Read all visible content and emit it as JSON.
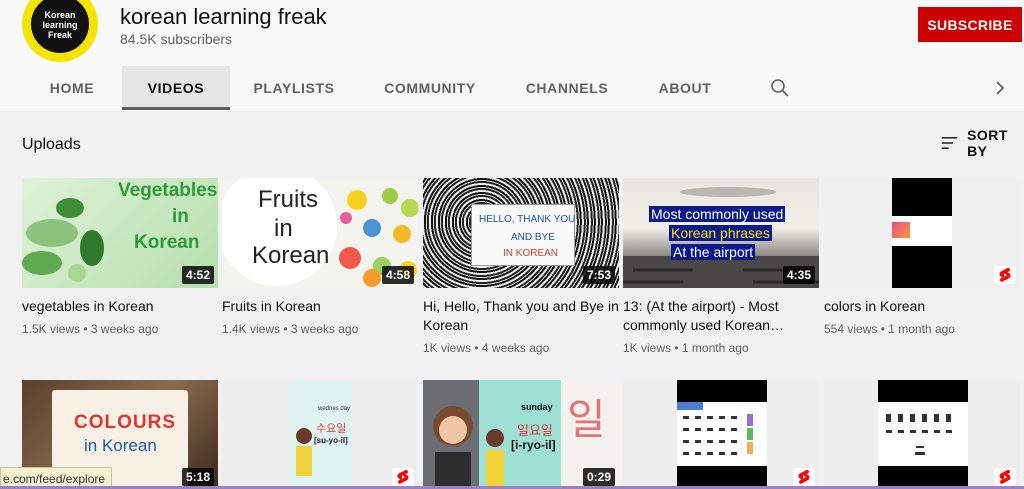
{
  "channel": {
    "name": "korean learning freak",
    "subscribers": "84.5K subscribers",
    "avatar_text": "Korean learning Freak",
    "subscribe_label": "SUBSCRIBE"
  },
  "tabs": [
    {
      "label": "HOME"
    },
    {
      "label": "VIDEOS",
      "active": true
    },
    {
      "label": "PLAYLISTS"
    },
    {
      "label": "COMMUNITY"
    },
    {
      "label": "CHANNELS"
    },
    {
      "label": "ABOUT"
    }
  ],
  "section": {
    "title": "Uploads",
    "sort_label": "SORT BY"
  },
  "videos_row1": [
    {
      "title": "vegetables in Korean",
      "views": "1.5K views",
      "age": "3 weeks ago",
      "duration": "4:52",
      "thumb_text": [
        "Vegetables",
        "in",
        "Korean"
      ]
    },
    {
      "title": "Fruits in Korean",
      "views": "1.4K views",
      "age": "3 weeks ago",
      "duration": "4:58",
      "thumb_text": [
        "Fruits",
        "in",
        "Korean"
      ]
    },
    {
      "title": "Hi, Hello, Thank you and Bye in Korean",
      "views": "1K views",
      "age": "4 weeks ago",
      "duration": "7:53",
      "thumb_text": [
        "HELLO, THANK YOU",
        "AND BYE",
        "IN KOREAN"
      ]
    },
    {
      "title": "13: (At the airport) - Most commonly used Korean…",
      "views": "1K views",
      "age": "1 month ago",
      "duration": "4:35",
      "thumb_text": [
        "Most commonly used",
        "Korean phrases",
        "At the airport"
      ]
    },
    {
      "title": "colors in Korean",
      "views": "554 views",
      "age": "1 month ago",
      "duration": "",
      "thumb_text": []
    }
  ],
  "videos_row2": [
    {
      "duration": "5:18",
      "thumb_text": [
        "COLOURS",
        "in Korean"
      ]
    },
    {
      "duration": "",
      "thumb_text": [
        "wednes day",
        "수요일",
        "[su-yo-il]"
      ]
    },
    {
      "duration": "0:29",
      "thumb_text": [
        "sunday",
        "일요일",
        "[i-ryo-il]",
        "일"
      ]
    },
    {
      "duration": "",
      "thumb_text": []
    },
    {
      "duration": "",
      "thumb_text": []
    }
  ],
  "status_url": "e.com/feed/explore",
  "colors": {
    "subscribe": "#cc0000",
    "avatar_yellow": "#f5e400"
  }
}
